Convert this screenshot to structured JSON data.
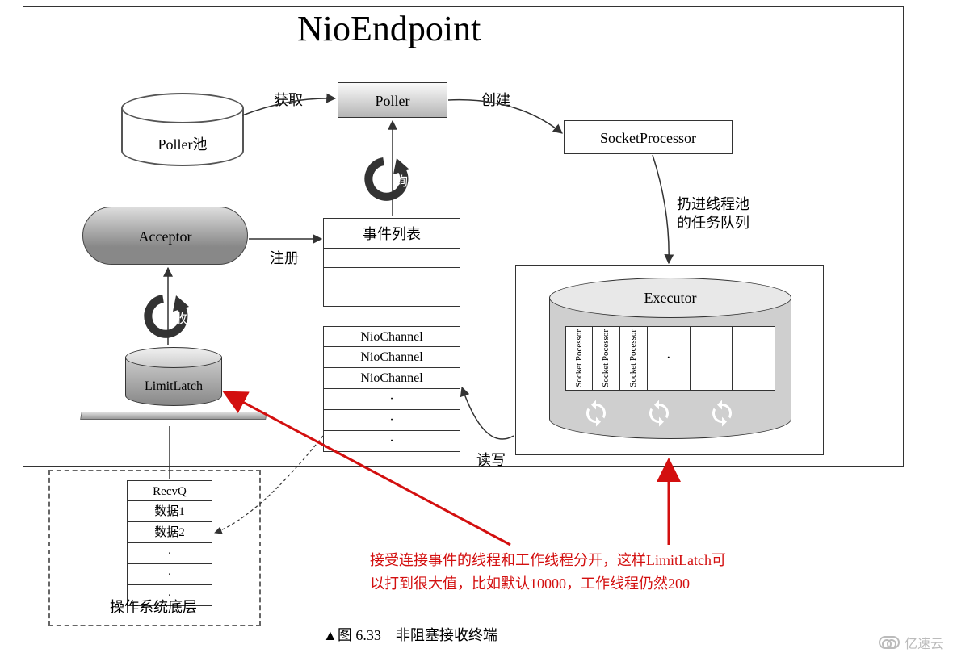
{
  "title": "NioEndpoint",
  "nodes": {
    "poller_pool": "Poller池",
    "poller": "Poller",
    "socket_processor": "SocketProcessor",
    "acceptor": "Acceptor",
    "event_list_header": "事件列表",
    "nio_channel_items": [
      "NioChannel",
      "NioChannel",
      "NioChannel",
      "·",
      "·",
      "·"
    ],
    "limit_latch": "LimitLatch",
    "executor": "Executor",
    "executor_slots": [
      "Socket\nPocessor",
      "Socket\nPocessor",
      "Socket\nPocessor"
    ]
  },
  "edge_labels": {
    "acquire": "获取",
    "create": "创建",
    "polling": "轮询",
    "register": "注册",
    "accept": "接收",
    "throw_to_pool": "扔进线程池\n的任务队列",
    "read_write": "读写"
  },
  "os_layer": {
    "recvq_items": [
      "RecvQ",
      "数据1",
      "数据2",
      "·",
      "·",
      "·"
    ],
    "label": "操作系统底层"
  },
  "annotation": {
    "line1": "接受连接事件的线程和工作线程分开，这样LimitLatch可",
    "line2": "以打到很大值，比如默认10000，工作线程仍然200"
  },
  "caption": "▲图 6.33　非阻塞接收终端",
  "watermark": "亿速云"
}
